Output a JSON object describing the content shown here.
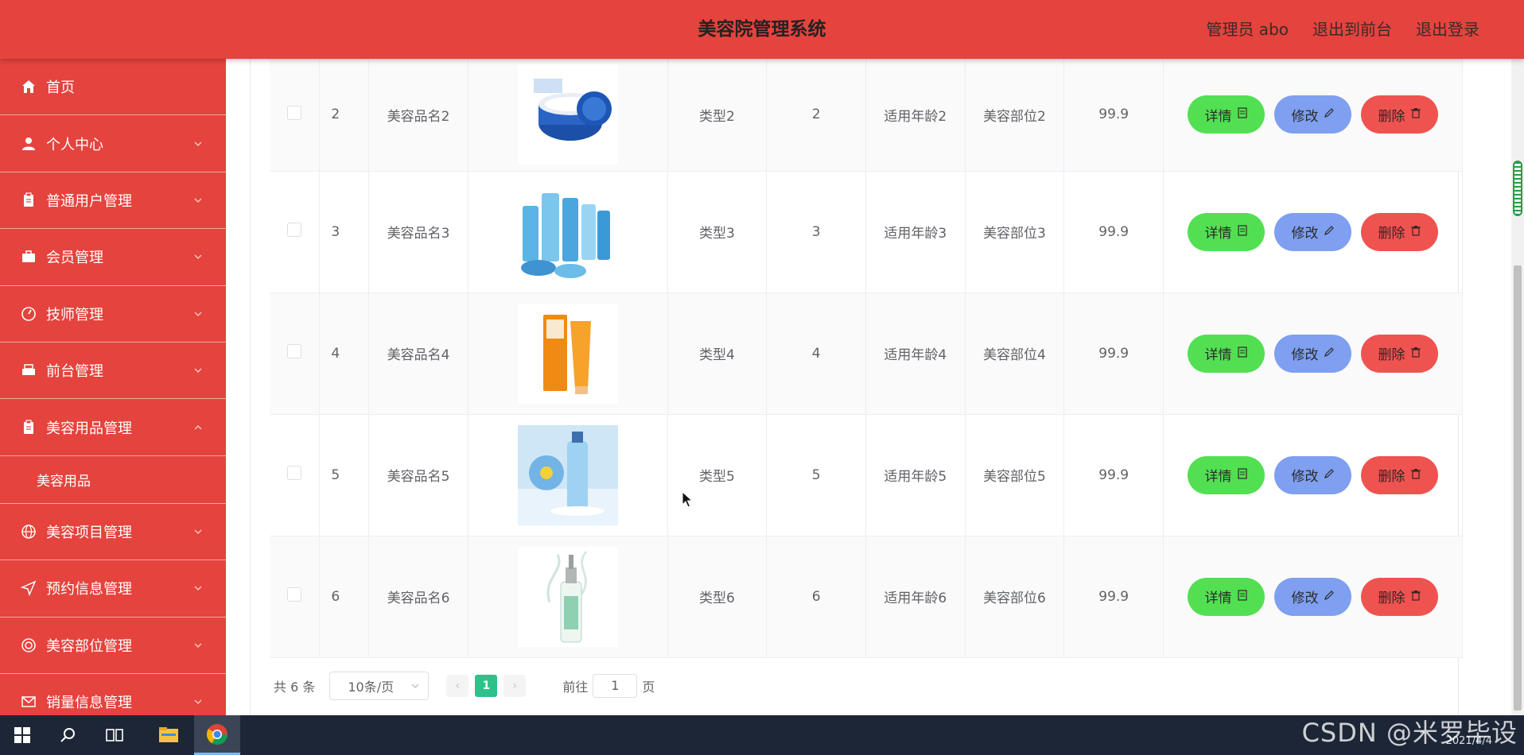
{
  "header": {
    "title": "美容院管理系统",
    "admin": "管理员 abo",
    "front": "退出到前台",
    "logout": "退出登录"
  },
  "sidebar": {
    "items": [
      {
        "label": "首页",
        "icon": "home-icon",
        "arrow": false
      },
      {
        "label": "个人中心",
        "icon": "user-icon",
        "arrow": true
      },
      {
        "label": "普通用户管理",
        "icon": "clipboard-icon",
        "arrow": true
      },
      {
        "label": "会员管理",
        "icon": "briefcase-icon",
        "arrow": true
      },
      {
        "label": "技师管理",
        "icon": "gauge-icon",
        "arrow": true
      },
      {
        "label": "前台管理",
        "icon": "printer-icon",
        "arrow": true
      }
    ],
    "expanded": {
      "label": "美容用品管理",
      "icon": "clipboard-icon",
      "sub": "美容用品"
    },
    "items2": [
      {
        "label": "美容项目管理",
        "icon": "globe-icon"
      },
      {
        "label": "预约信息管理",
        "icon": "send-icon"
      },
      {
        "label": "美容部位管理",
        "icon": "target-icon"
      },
      {
        "label": "销量信息管理",
        "icon": "mail-icon"
      }
    ]
  },
  "table": {
    "rows": [
      {
        "id": "2",
        "name": "美容品名2",
        "type": "类型2",
        "num": "2",
        "age": "适用年龄2",
        "part": "美容部位2",
        "price": "99.9",
        "img": "cream-jar-image"
      },
      {
        "id": "3",
        "name": "美容品名3",
        "type": "类型3",
        "num": "3",
        "age": "适用年龄3",
        "part": "美容部位3",
        "price": "99.9",
        "img": "skincare-set-image"
      },
      {
        "id": "4",
        "name": "美容品名4",
        "type": "类型4",
        "num": "4",
        "age": "适用年龄4",
        "part": "美容部位4",
        "price": "99.9",
        "img": "sunscreen-image"
      },
      {
        "id": "5",
        "name": "美容品名5",
        "type": "类型5",
        "num": "5",
        "age": "适用年龄5",
        "part": "美容部位5",
        "price": "99.9",
        "img": "serum-bottle-image"
      },
      {
        "id": "6",
        "name": "美容品名6",
        "type": "类型6",
        "num": "6",
        "age": "适用年龄6",
        "part": "美容部位6",
        "price": "99.9",
        "img": "essence-bottle-image"
      }
    ],
    "actions": {
      "detail": "详情",
      "edit": "修改",
      "delete": "删除"
    }
  },
  "pager": {
    "total": "共 6 条",
    "size": "10条/页",
    "page": "1",
    "goto": "前往",
    "goto_value": "1",
    "unit": "页"
  },
  "taskbar": {
    "date": "2021/4/4",
    "watermark": "CSDN @米罗毕设"
  },
  "colors": {
    "primary": "#e5433d",
    "detail": "#52e052",
    "edit": "#7f9ff0",
    "delete": "#ef5350",
    "active_page": "#2cc28a"
  }
}
